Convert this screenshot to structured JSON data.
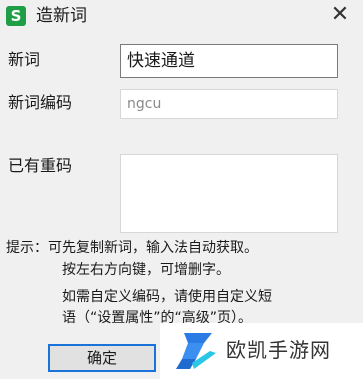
{
  "window": {
    "app_icon_letter": "S",
    "title": "造新词",
    "close_glyph": "✕"
  },
  "form": {
    "new_word_label": "新词",
    "new_word_value": "快速通道",
    "code_label": "新词编码",
    "code_value": "ngcu",
    "duplicate_label": "已有重码",
    "duplicate_value": ""
  },
  "hints": {
    "line1": "提示：可先复制新词，输入法自动获取。",
    "line2": "按左右方向键，可增删字。",
    "line3": "如需自定义编码，请使用自定义短",
    "line4": "语（“设置属性”的“高级”页）。"
  },
  "buttons": {
    "ok_label": "确定"
  },
  "watermark": {
    "text": "欧凯手游网"
  },
  "colors": {
    "app_icon": "#1f9e47",
    "focus_border": "#1a73d9",
    "dialog_bg": "#f0f0f0"
  }
}
